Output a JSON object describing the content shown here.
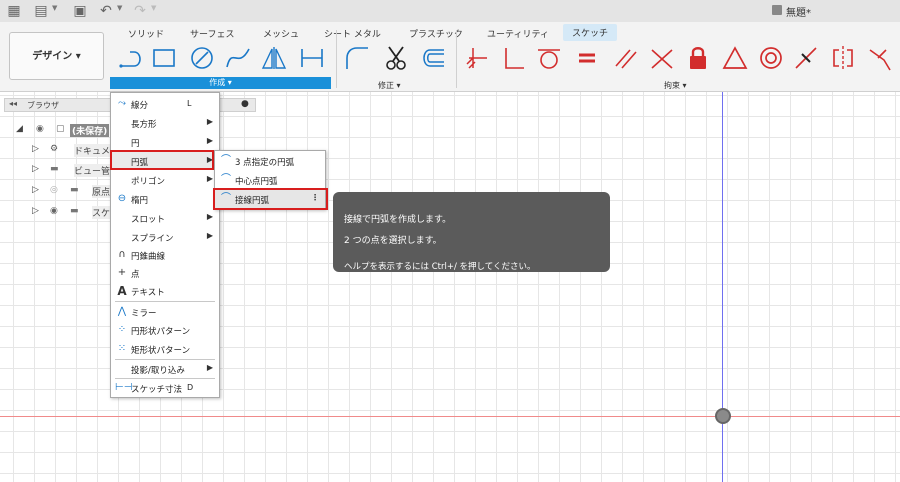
{
  "titlebar": {
    "doc_title": "無題*"
  },
  "tabs": [
    "ソリッド",
    "サーフェス",
    "メッシュ",
    "シート メタル",
    "プラスチック",
    "ユーティリティ",
    "スケッチ"
  ],
  "workspace": {
    "label": "デザイン ▾"
  },
  "groups": {
    "create": "作成 ▾",
    "modify": "修正 ▾",
    "constraints": "拘束 ▾"
  },
  "browser": {
    "title": "ブラウザ",
    "items": [
      {
        "label": "(未保存)"
      },
      {
        "label": "ドキュメン"
      },
      {
        "label": "ビュー管理"
      },
      {
        "label": "原点"
      },
      {
        "label": "スケ"
      }
    ]
  },
  "create_menu": [
    {
      "label": "線分",
      "shortcut": "L",
      "icon": "line-icon"
    },
    {
      "label": "長方形",
      "arrow": "▶"
    },
    {
      "label": "円",
      "arrow": "▶"
    },
    {
      "label": "円弧",
      "arrow": "▶"
    },
    {
      "label": "ポリゴン",
      "arrow": "▶"
    },
    {
      "label": "楕円",
      "icon": "ellipse-icon"
    },
    {
      "label": "スロット",
      "arrow": "▶"
    },
    {
      "label": "スプライン",
      "arrow": "▶"
    },
    {
      "label": "円錐曲線",
      "icon": "conic-icon"
    },
    {
      "label": "点",
      "icon": "point-icon"
    },
    {
      "label": "テキスト",
      "icon": "text-icon"
    },
    {
      "label": "ミラー",
      "icon": "mirror-icon"
    },
    {
      "label": "円形状パターン",
      "icon": "circular-pattern-icon"
    },
    {
      "label": "矩形状パターン",
      "icon": "rectangular-pattern-icon"
    },
    {
      "label": "投影/取り込み",
      "arrow": "▶"
    },
    {
      "label": "スケッチ寸法",
      "shortcut": "D",
      "icon": "dimension-icon"
    }
  ],
  "arc_submenu": [
    {
      "label": "3 点指定の円弧"
    },
    {
      "label": "中心点円弧"
    },
    {
      "label": "接線円弧",
      "more": "⋮"
    }
  ],
  "tooltip": {
    "line1": "接線で円弧を作成します。",
    "line2": "2 つの点を選択します。",
    "line3": "ヘルプを表示するには Ctrl+/ を押してください。"
  },
  "colors": {
    "accent": "#1a90d9",
    "highlight": "#d81e1e",
    "constraint_red": "#d22d2d"
  }
}
